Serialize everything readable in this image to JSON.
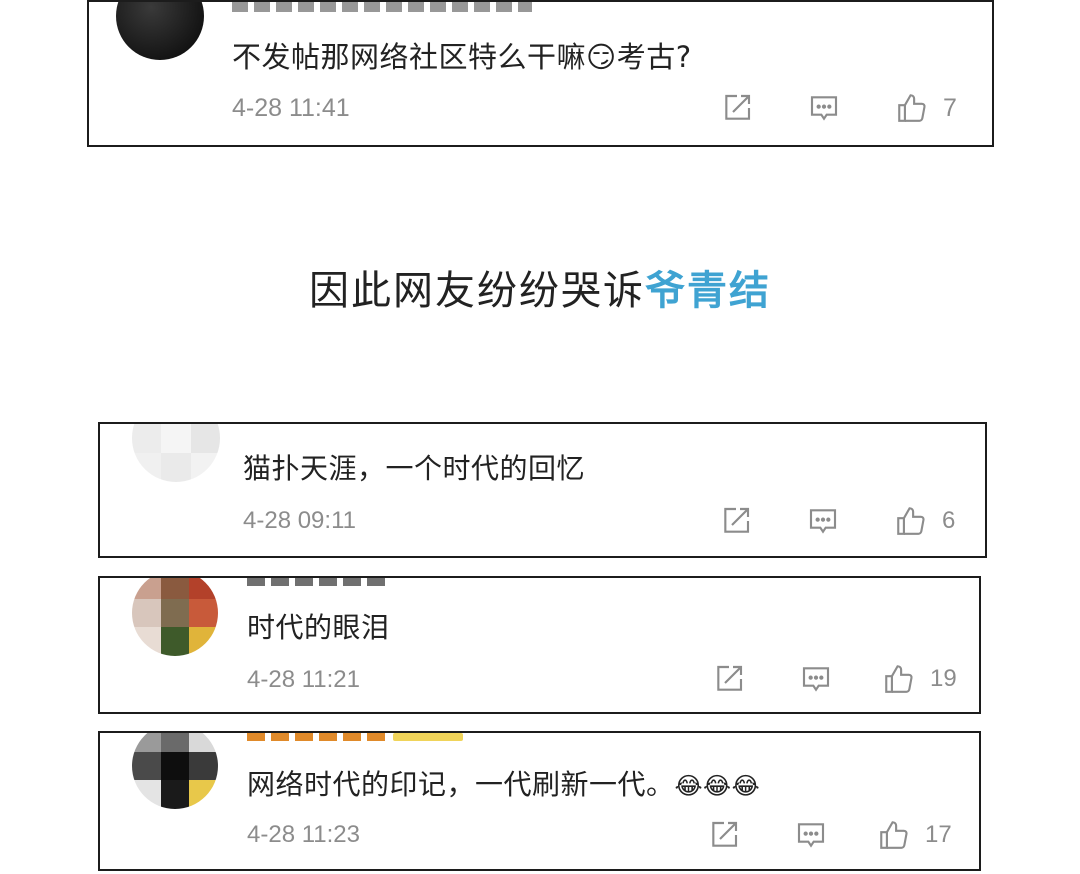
{
  "headline": {
    "prefix": "因此网友纷纷哭诉",
    "highlight": "爷青结"
  },
  "comments": [
    {
      "text": "不发帖那网络社区特么干嘛",
      "emoji": "😏",
      "suffix": "考古?",
      "time": "4-28 11:41",
      "likes": "7"
    },
    {
      "text": "猫扑天涯，一个时代的回忆",
      "time": "4-28 09:11",
      "likes": "6"
    },
    {
      "text": "时代的眼泪",
      "time": "4-28 11:21",
      "likes": "19"
    },
    {
      "text": "网络时代的印记，一代刷新一代。",
      "emoji": "😂😂😂",
      "time": "4-28 11:23",
      "likes": "17"
    }
  ],
  "icons": {
    "share": "share-icon",
    "reply": "comment-icon",
    "like": "thumbs-up-icon"
  },
  "colors": {
    "highlight": "#3fa3d2",
    "border": "#1c1c1c",
    "meta": "#8c8c8c"
  }
}
